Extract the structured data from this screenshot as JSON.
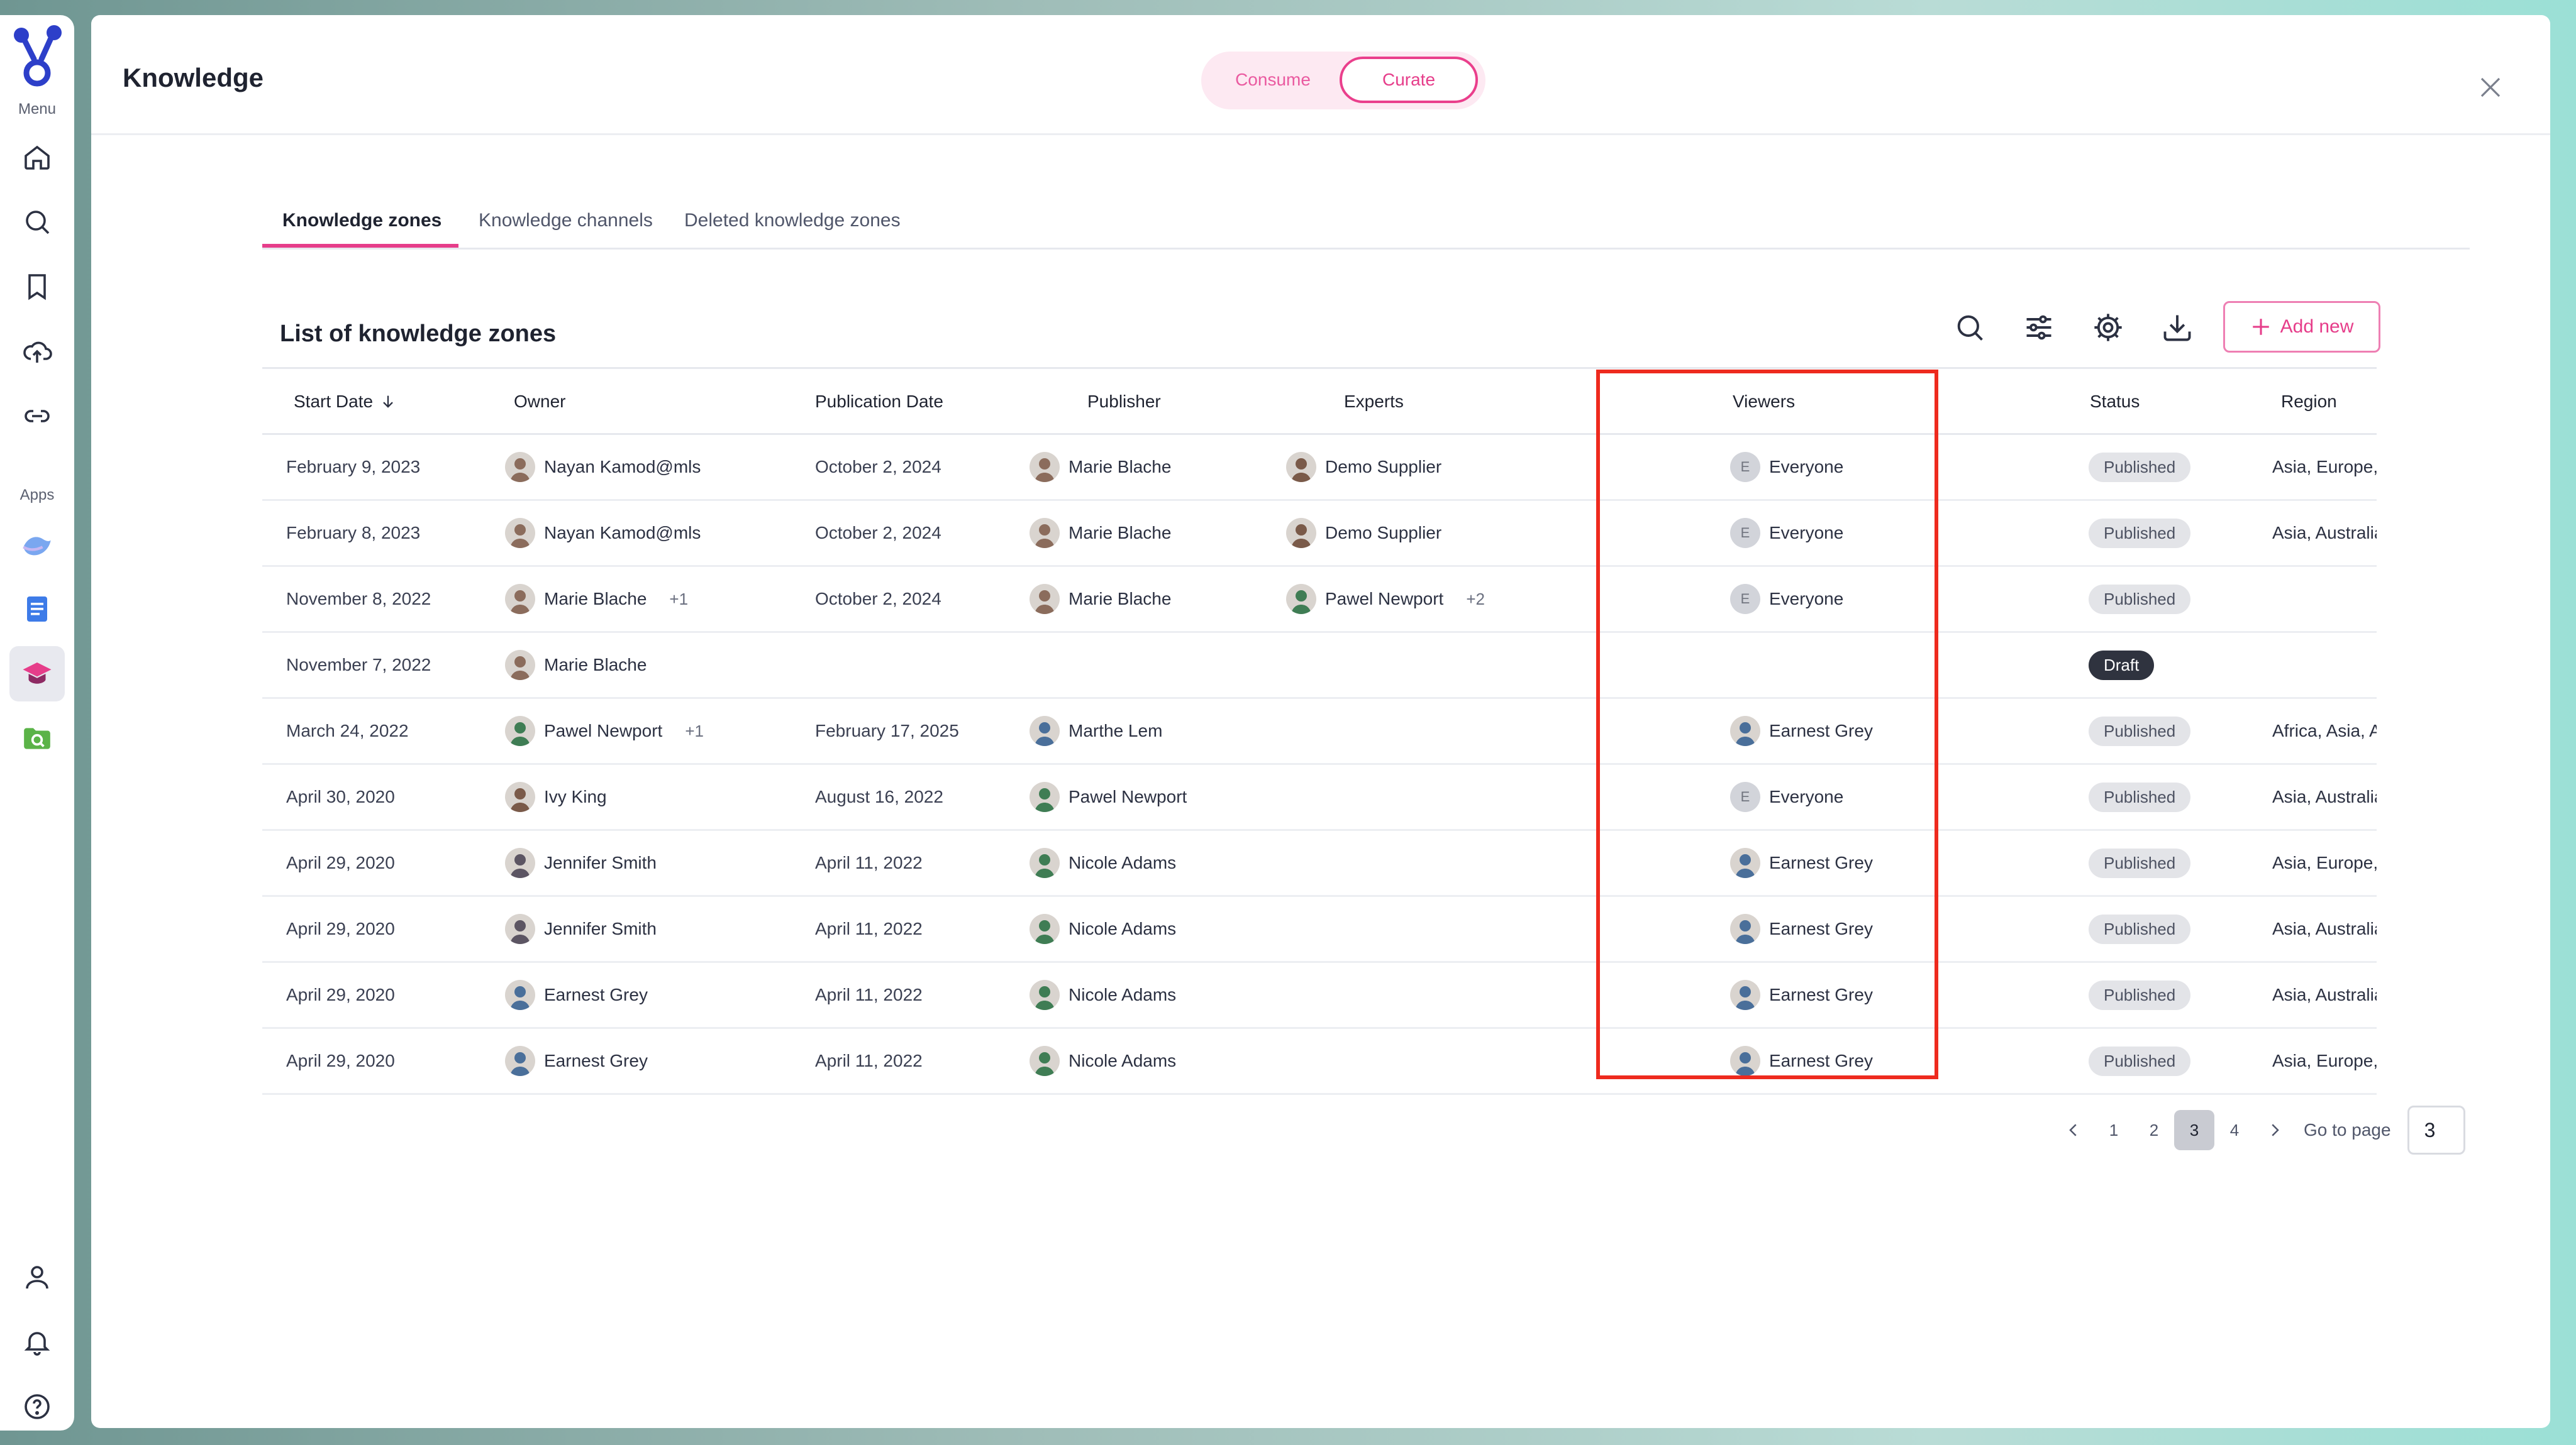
{
  "rail": {
    "menu_caption": "Menu",
    "apps_caption": "Apps"
  },
  "header": {
    "title": "Knowledge",
    "mode_consume": "Consume",
    "mode_curate": "Curate",
    "active_mode": "Curate"
  },
  "tabs": [
    {
      "label": "Knowledge zones",
      "active": true
    },
    {
      "label": "Knowledge channels",
      "active": false
    },
    {
      "label": "Deleted knowledge zones",
      "active": false
    }
  ],
  "list": {
    "title": "List of knowledge zones",
    "add_new_label": "Add new"
  },
  "columns": [
    "Start Date",
    "Owner",
    "Publication Date",
    "Publisher",
    "Experts",
    "Viewers",
    "Status",
    "Region"
  ],
  "rows": [
    {
      "start": "February 9, 2023",
      "owner": "Nayan Kamod@mls",
      "owner_extra": "",
      "pub": "October 2, 2024",
      "publisher": "Marie Blache",
      "expert": "Demo Supplier",
      "expert_extra": "",
      "viewer": "Everyone",
      "viewer_type": "everyone",
      "status": "Published",
      "region": "Asia, Europe, North Ame"
    },
    {
      "start": "February 8, 2023",
      "owner": "Nayan Kamod@mls",
      "owner_extra": "",
      "pub": "October 2, 2024",
      "publisher": "Marie Blache",
      "expert": "Demo Supplier",
      "expert_extra": "",
      "viewer": "Everyone",
      "viewer_type": "everyone",
      "status": "Published",
      "region": "Asia, Australia, Europe, N"
    },
    {
      "start": "November 8, 2022",
      "owner": "Marie Blache",
      "owner_extra": "+1",
      "pub": "October 2, 2024",
      "publisher": "Marie Blache",
      "expert": "Pawel Newport",
      "expert_extra": "+2",
      "viewer": "Everyone",
      "viewer_type": "everyone",
      "status": "Published",
      "region": ""
    },
    {
      "start": "November 7, 2022",
      "owner": "Marie Blache",
      "owner_extra": "",
      "pub": "",
      "publisher": "",
      "expert": "",
      "expert_extra": "",
      "viewer": "",
      "viewer_type": "",
      "status": "Draft",
      "region": ""
    },
    {
      "start": "March 24, 2022",
      "owner": "Pawel Newport",
      "owner_extra": "+1",
      "pub": "February 17, 2025",
      "publisher": "Marthe Lem",
      "expert": "",
      "expert_extra": "",
      "viewer": "Earnest Grey",
      "viewer_type": "person",
      "status": "Published",
      "region": "Africa, Asia, Australia, Eu"
    },
    {
      "start": "April 30, 2020",
      "owner": "Ivy King",
      "owner_extra": "",
      "pub": "August 16, 2022",
      "publisher": "Pawel Newport",
      "expert": "",
      "expert_extra": "",
      "viewer": "Everyone",
      "viewer_type": "everyone",
      "status": "Published",
      "region": "Asia, Australia, Europe, L"
    },
    {
      "start": "April 29, 2020",
      "owner": "Jennifer Smith",
      "owner_extra": "",
      "pub": "April 11, 2022",
      "publisher": "Nicole Adams",
      "expert": "",
      "expert_extra": "",
      "viewer": "Earnest Grey",
      "viewer_type": "person",
      "status": "Published",
      "region": "Asia, Europe, North Ame"
    },
    {
      "start": "April 29, 2020",
      "owner": "Jennifer Smith",
      "owner_extra": "",
      "pub": "April 11, 2022",
      "publisher": "Nicole Adams",
      "expert": "",
      "expert_extra": "",
      "viewer": "Earnest Grey",
      "viewer_type": "person",
      "status": "Published",
      "region": "Asia, Australia, Europe, N"
    },
    {
      "start": "April 29, 2020",
      "owner": "Earnest Grey",
      "owner_extra": "",
      "pub": "April 11, 2022",
      "publisher": "Nicole Adams",
      "expert": "",
      "expert_extra": "",
      "viewer": "Earnest Grey",
      "viewer_type": "person",
      "status": "Published",
      "region": "Asia, Australia, Europe, N"
    },
    {
      "start": "April 29, 2020",
      "owner": "Earnest Grey",
      "owner_extra": "",
      "pub": "April 11, 2022",
      "publisher": "Nicole Adams",
      "expert": "",
      "expert_extra": "",
      "viewer": "Earnest Grey",
      "viewer_type": "person",
      "status": "Published",
      "region": "Asia, Europe, North Ame"
    }
  ],
  "avatar_initial": "E",
  "pagination": {
    "pages": [
      "1",
      "2",
      "3",
      "4"
    ],
    "current": "3",
    "goto_label": "Go to page",
    "goto_value": "3"
  },
  "colors": {
    "accent": "#e63d8a",
    "highlight": "#ee2a1e"
  }
}
